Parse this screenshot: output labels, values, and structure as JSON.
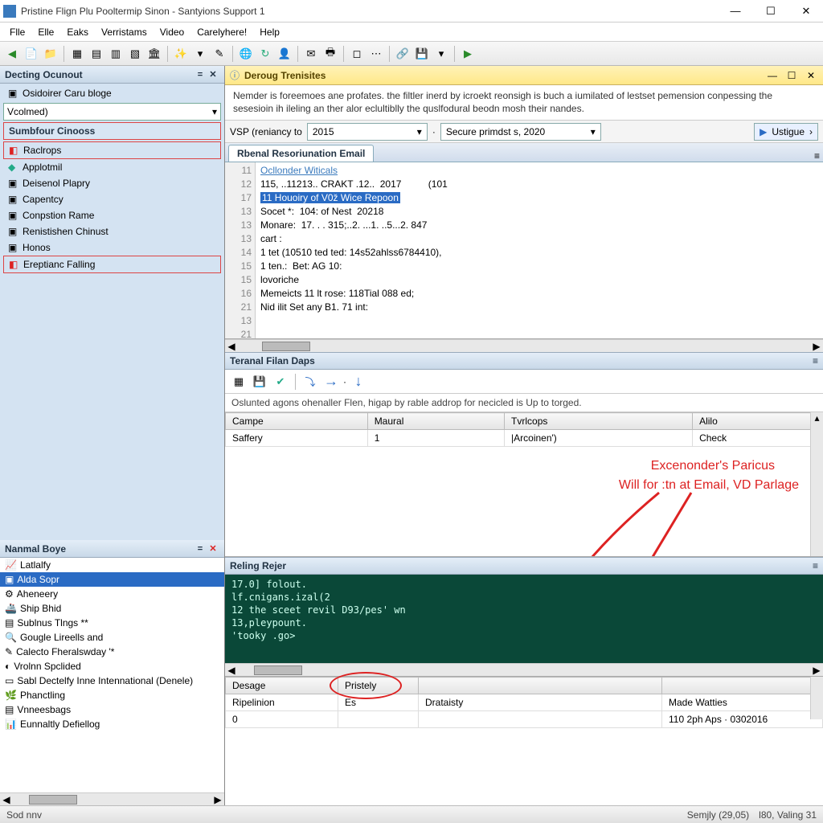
{
  "title": "Pristine Flign Plu Pooltermip Sinon - Santyions Support 1",
  "menu": [
    "Flle",
    "Elle",
    "Eaks",
    "Verristams",
    "Video",
    "Carelyhere!",
    "Help"
  ],
  "left_panel": {
    "header": "Decting Ocunout",
    "top_items": [
      "Osidoirer Caru bloge",
      "Vcolmed)"
    ],
    "group_header": "Sumbfour Cinooss",
    "items": [
      "Raclrops",
      "Applotmil",
      "Deisenol Plapry",
      "Capentcy",
      "Conpstion Rame",
      "Renistishen Chinust",
      "Honos",
      "Ereptianc Falling"
    ]
  },
  "nav_panel": {
    "header": "Nanmal Boye",
    "items": [
      "Latlalfy",
      "Alda Sopr",
      "Aheneery",
      "Ship Bhid",
      "Sublnus Tlngs **",
      "Gougle Lireells and",
      "Calecto Fheralswday '*",
      "Vrolnn Spclided",
      "Sabl Dectelfy Inne Intennational (Denele)",
      "Phanctling",
      "Vnneesbags",
      "Eunnaltly Defiellog"
    ]
  },
  "right_header": "Deroug Trenisites",
  "description": "Nemder is foreemoes ane profates. the filtler inerd by icroekt reonsigh is buch a iumilated of lestset pemension conpessing the sesesioin ih ileling an ther alor eclultiblly the quslfodural beodn mosh their nandes.",
  "filter": {
    "left_label": "VSP (reniancy to",
    "left_value": "2015",
    "mid_value": "Secure primdst s, 2020",
    "btn": "Ustigue",
    "btn_arrow": "›"
  },
  "tab": "Rbenal Resoriunation Email",
  "code": {
    "gutter": [
      "11",
      "12",
      "17",
      "13",
      "13",
      "13",
      "14",
      "15",
      "15",
      "16",
      "21",
      "13",
      "21"
    ],
    "lines": [
      "<span class='ln-link'>Ocllonder Witicals</span>",
      "115, ..11213.. CRAKT .12..  2017          (101",
      "<span class='hl'>11 Houoiry of V0ž Wice Repoon</span>",
      "Socet *:  104: of Nest  20218",
      "Monare:  17. . . 315;..2. ...1. ..5...2. 847",
      "",
      "cart :",
      "1 tet (10510 ted ted: 14s52ahlss6784410),",
      "1 ten.:  Bet: AG 10:",
      "lovoriche",
      "Memeicts 11 lt rose: 118Tial 088 ed;",
      "Nid ilit Set any B1. 71 int:",
      ""
    ]
  },
  "sub1_header": "Teranal Filan Daps",
  "sub1_note": "Oslunted agons ohenaller Flen, higap by rable addrop for necicled is Up to torged.",
  "grid": {
    "headers": [
      "Campe",
      "Maural",
      "Tvrlcops",
      "Alilo"
    ],
    "row": [
      "Saffery",
      "1",
      "|Arcoinen')",
      "Check"
    ]
  },
  "annotation": {
    "line1": "Excenonder's Paricus",
    "line2": "Will for :tn at Email, VD Parlage"
  },
  "sub2_header": "Reling Rejer",
  "console_lines": [
    "17.0] folout.",
    "lf.cnigans.izal(2",
    "12 the sceet revil D93/pes' wn",
    "13,pleypount.",
    "'tooky .go>"
  ],
  "bottom_grid": {
    "headers": [
      "Desage",
      "Pristely",
      "",
      ""
    ],
    "row": [
      "Ripelinion",
      "Es",
      "Drataisty",
      "Made Watties"
    ],
    "row2": [
      "0",
      "",
      "",
      "110 2ph Aps · 0302016"
    ]
  },
  "status": {
    "left": "Sod nnv",
    "right1": "Semjly (29,05)",
    "right2": "l80, Valing 31"
  }
}
